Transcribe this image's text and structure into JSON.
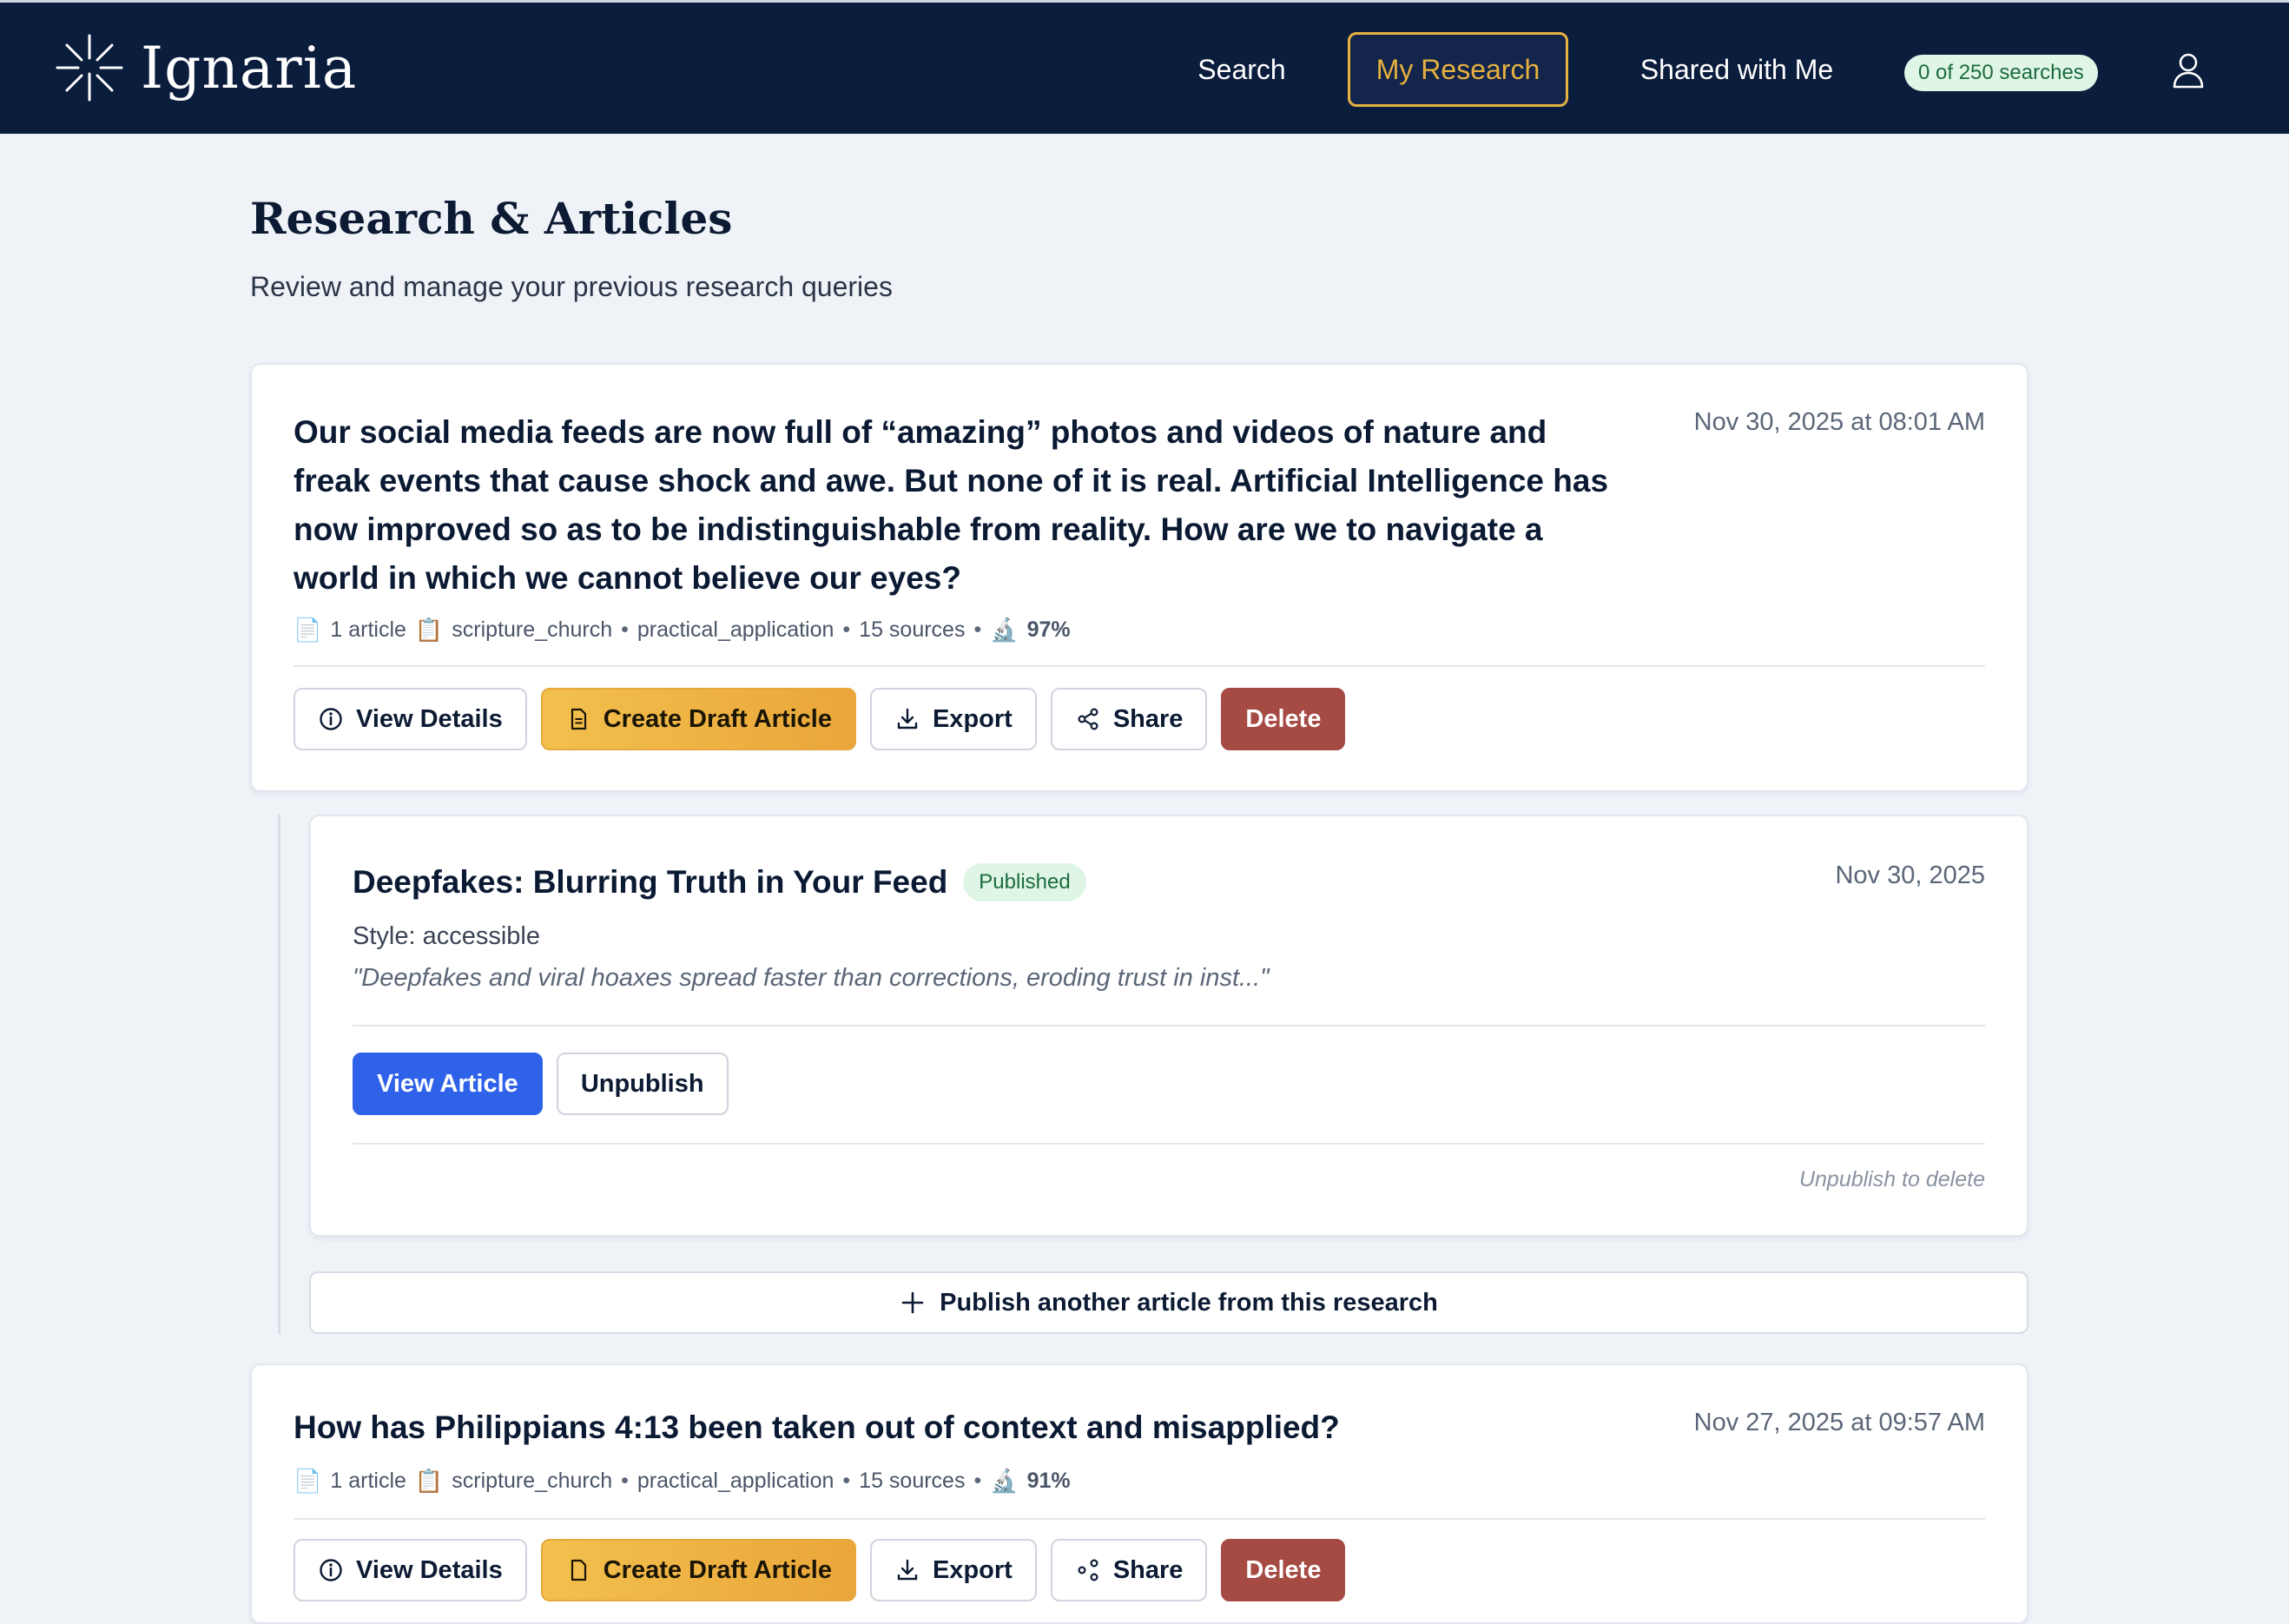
{
  "brand": {
    "name": "Ignaria"
  },
  "nav": {
    "search": "Search",
    "my_research": "My Research",
    "shared": "Shared with Me",
    "quota": "0 of 250 searches"
  },
  "page": {
    "title": "Research & Articles",
    "subtitle": "Review and manage your previous research queries"
  },
  "research": [
    {
      "question": "Our social media feeds are now full of “amazing” photos and videos of nature and freak events that cause shock and awe. But none of it is real. Artificial Intelligence has now improved so as to be indistinguishable from reality. How are we to navigate a world in which we cannot believe our eyes?",
      "date": "Nov 30, 2025 at 08:01 AM",
      "meta": {
        "articles": "1 article",
        "category": "scripture_church",
        "angle": "practical_application",
        "sources": "15 sources",
        "score": "97%"
      }
    },
    {
      "question": "How has Philippians 4:13 been taken out of context and misapplied?",
      "date": "Nov 27, 2025 at 09:57 AM",
      "meta": {
        "articles": "1 article",
        "category": "scripture_church",
        "angle": "practical_application",
        "sources": "15 sources",
        "score": "91%"
      }
    }
  ],
  "actions": {
    "view_details": "View Details",
    "create_draft": "Create Draft Article",
    "export": "Export",
    "share": "Share",
    "delete": "Delete"
  },
  "article": {
    "title": "Deepfakes: Blurring Truth in Your Feed",
    "status": "Published",
    "date": "Nov 30, 2025",
    "style": "Style: accessible",
    "excerpt": "\"Deepfakes and viral hoaxes spread faster than corrections, eroding trust in inst...\"",
    "view_label": "View Article",
    "unpublish_label": "Unpublish",
    "note": "Unpublish to delete"
  },
  "publish_more": "Publish another article from this research",
  "colors": {
    "header_bg": "#0b1d3c",
    "accent_gold": "#e6b140",
    "danger": "#a64a44",
    "primary_blue": "#2e62e8",
    "success_bg": "#dff6e6",
    "success_text": "#1d6b3d"
  },
  "icons": [
    "logo-spark-icon",
    "user-icon",
    "document-icon",
    "clipboard-icon",
    "microscope-icon",
    "info-icon",
    "file-icon",
    "download-icon",
    "share-icon",
    "plus-icon"
  ]
}
